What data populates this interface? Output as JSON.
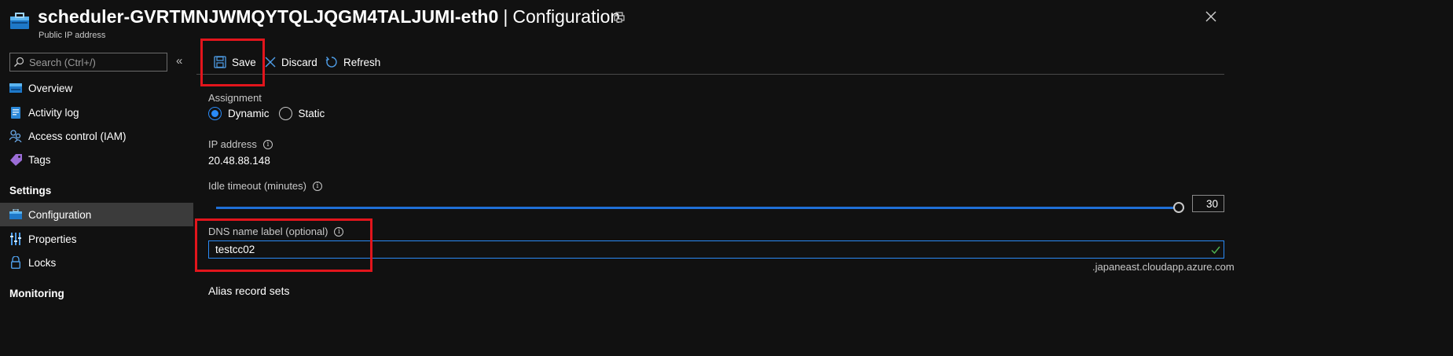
{
  "header": {
    "resource_name": "scheduler-GVRTMNJWMQYTQLJQGM4TALJUMI-eth0",
    "separator": "|",
    "page_title": "Configuration",
    "resource_type": "Public IP address"
  },
  "sidebar": {
    "search_placeholder": "Search (Ctrl+/)",
    "collapse_glyph": "«",
    "items": [
      {
        "label": "Overview",
        "icon": "overview-icon"
      },
      {
        "label": "Activity log",
        "icon": "activity-log-icon"
      },
      {
        "label": "Access control (IAM)",
        "icon": "iam-icon"
      },
      {
        "label": "Tags",
        "icon": "tag-icon"
      }
    ],
    "settings_label": "Settings",
    "settings_items": [
      {
        "label": "Configuration",
        "icon": "configuration-icon",
        "active": true
      },
      {
        "label": "Properties",
        "icon": "properties-icon"
      },
      {
        "label": "Locks",
        "icon": "lock-icon"
      }
    ],
    "monitoring_label": "Monitoring"
  },
  "toolbar": {
    "save_label": "Save",
    "discard_label": "Discard",
    "refresh_label": "Refresh"
  },
  "form": {
    "assignment_label": "Assignment",
    "assignment_options": [
      "Dynamic",
      "Static"
    ],
    "assignment_selected": "Dynamic",
    "ip_address_label": "IP address",
    "ip_address_value": "20.48.88.148",
    "idle_timeout_label": "Idle timeout (minutes)",
    "idle_timeout_value": "30",
    "idle_timeout_fraction": 1.0,
    "dns_label": "DNS name label (optional)",
    "dns_value": "testcc02",
    "dns_suffix": ".japaneast.cloudapp.azure.com",
    "alias_heading": "Alias record sets"
  },
  "colors": {
    "background": "#111111",
    "accent": "#2a8af6",
    "highlight": "#e2151c",
    "valid": "#4caf50"
  }
}
